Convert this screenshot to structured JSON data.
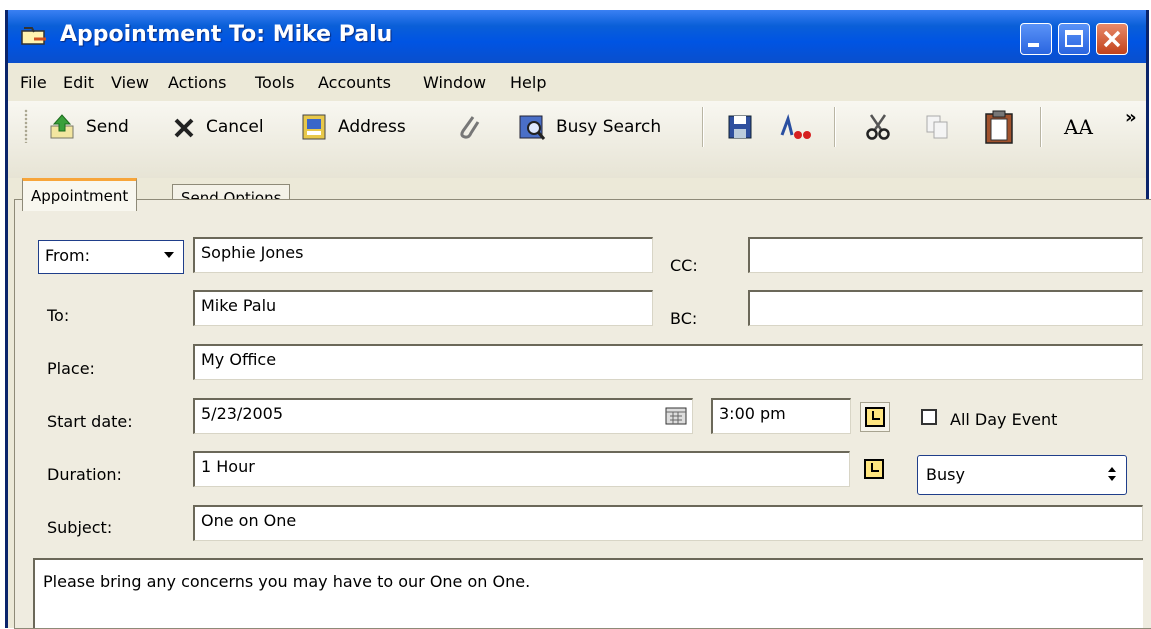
{
  "window": {
    "title": "Appointment To: Mike Palu"
  },
  "menu": [
    "File",
    "Edit",
    "View",
    "Actions",
    "Tools",
    "Accounts",
    "Window",
    "Help"
  ],
  "toolbar": {
    "send": "Send",
    "cancel": "Cancel",
    "address": "Address",
    "busy_search": "Busy Search",
    "font_glyph": "AA",
    "overflow_glyph": "»"
  },
  "tabs": {
    "appointment": "Appointment",
    "send_options": "Send Options"
  },
  "form": {
    "from_label": "From:",
    "from_value": "Sophie Jones",
    "cc_label": "CC:",
    "cc_value": "",
    "to_label": "To:",
    "to_value": "Mike Palu",
    "bc_label": "BC:",
    "bc_value": "",
    "place_label": "Place:",
    "place_value": "My Office",
    "start_date_label": "Start date:",
    "start_date_value": "5/23/2005",
    "start_time_value": "3:00 pm",
    "all_day_label": "All Day Event",
    "all_day_checked": false,
    "duration_label": "Duration:",
    "duration_value": "1 Hour",
    "show_as_value": "Busy",
    "subject_label": "Subject:",
    "subject_value": "One on One",
    "message": "Please bring any concerns you may have to our One on One."
  },
  "colors": {
    "titlebar": "#0054e3",
    "close": "#c2421b",
    "tab_accent": "#f7a53a",
    "face": "#ece9d8"
  }
}
